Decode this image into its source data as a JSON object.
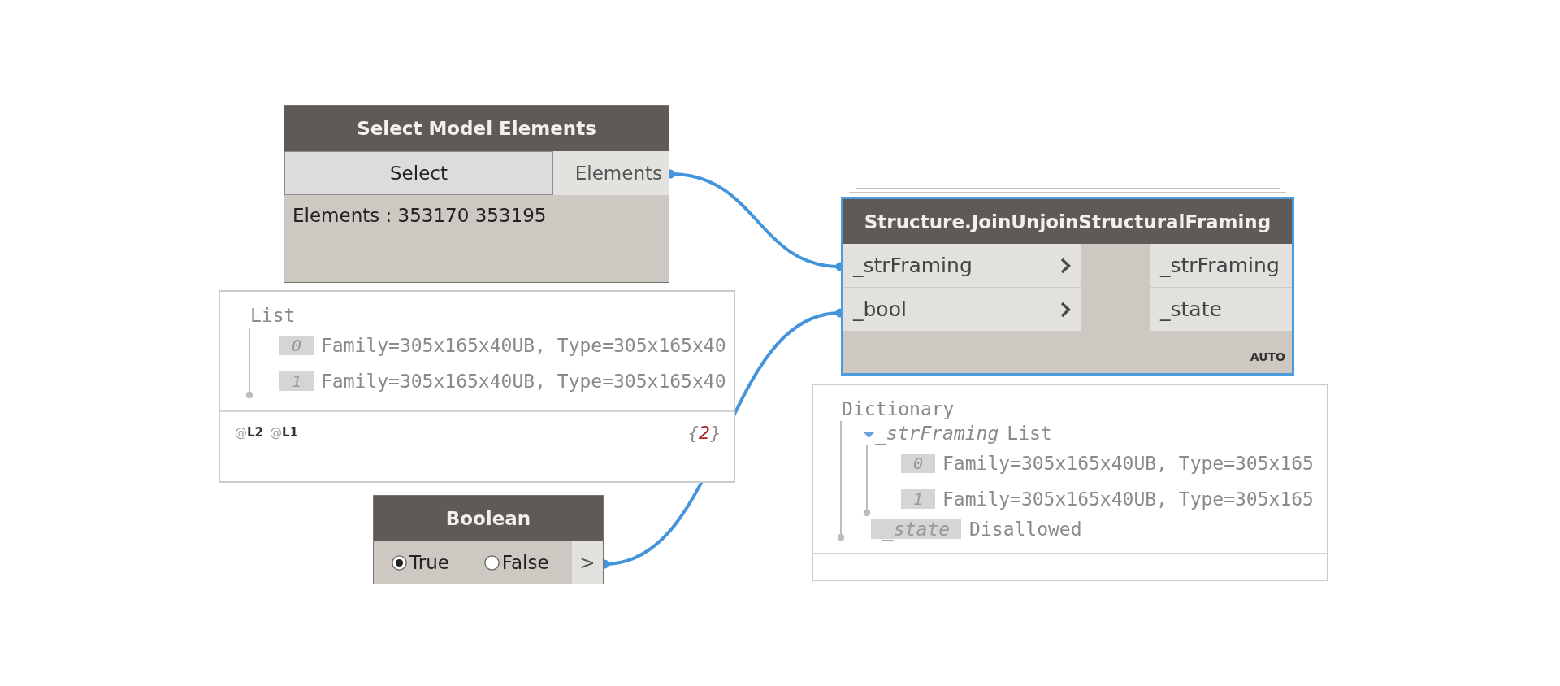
{
  "nodes": [
    {
      "kind": "select",
      "title": "Select Model Elements",
      "selected": false,
      "button": "Select",
      "outputs": [
        {
          "name": "Elements"
        }
      ],
      "summary": "Elements : 353170 353195",
      "preview": {
        "kind": "list",
        "label": "List",
        "children": [
          {
            "kind": "item",
            "index": "0",
            "value": "Family=305x165x40UB, Type=305x165x40"
          },
          {
            "kind": "item",
            "index": "1",
            "value": "Family=305x165x40UB, Type=305x165x40"
          }
        ],
        "levels": [
          "@**L2**",
          "@**L1**"
        ],
        "count": "{*2*}"
      }
    },
    {
      "kind": "boolean",
      "title": "Boolean",
      "selected": false,
      "options": [
        {
          "label": "True",
          "selected": true
        },
        {
          "label": "False",
          "selected": false
        }
      ],
      "outputs": [
        {
          "name": ">"
        }
      ]
    },
    {
      "kind": "function",
      "title": "Structure.JoinUnjoinStructuralFraming",
      "selected": true,
      "stacked": true,
      "inputs": [
        {
          "name": "_strFraming"
        },
        {
          "name": "_bool"
        }
      ],
      "outputs": [
        {
          "name": "_strFraming"
        },
        {
          "name": "_state"
        }
      ],
      "lacing": "AUTO",
      "preview": {
        "kind": "dictionary",
        "label": "Dictionary",
        "children": [
          {
            "kind": "list",
            "key": "_strFraming",
            "type": "List",
            "expanded": true,
            "children": [
              {
                "kind": "item",
                "index": "0",
                "value": "Family=305x165x40UB, Type=305x165"
              },
              {
                "kind": "item",
                "index": "1",
                "value": "Family=305x165x40UB, Type=305x165"
              }
            ]
          },
          {
            "kind": "value",
            "key": "_state",
            "value": "Disallowed"
          }
        ]
      }
    }
  ]
}
